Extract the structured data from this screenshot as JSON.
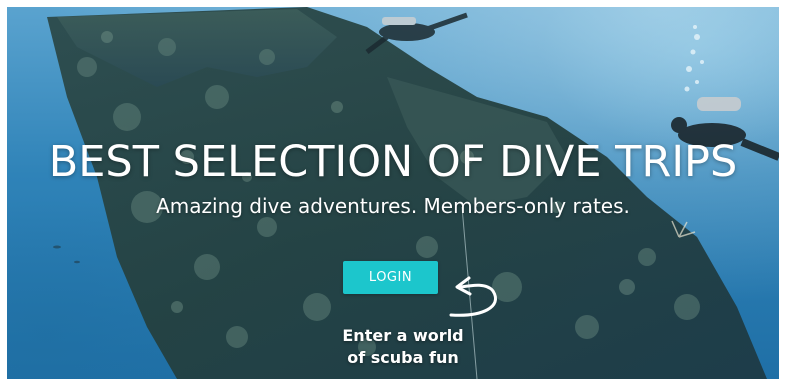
{
  "hero": {
    "headline": "BEST SELECTION OF DIVE TRIPS",
    "subheadline": "Amazing dive adventures. Members-only rates.",
    "login_label": "LOGIN",
    "callout_line1": "Enter a world",
    "callout_line2": "of scuba fun",
    "background_description_icon": "underwater-shipwreck-image",
    "colors": {
      "button": "#1cc6cc",
      "text": "#ffffff",
      "water": "#2f83b8"
    }
  }
}
